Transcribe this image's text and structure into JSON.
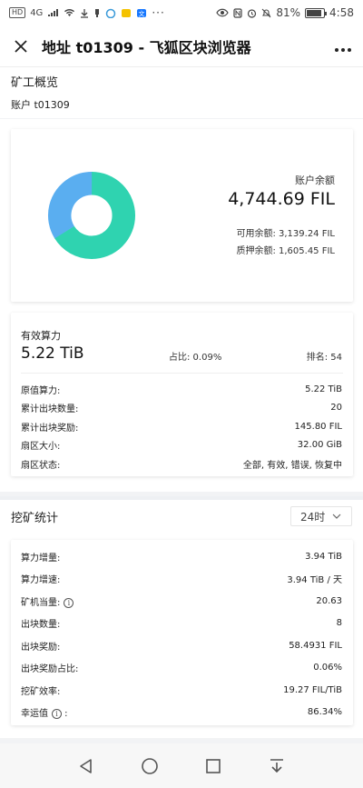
{
  "status_bar": {
    "hd": "HD",
    "network": "4G",
    "dots": "···",
    "battery": "81%",
    "time": "4:58",
    "battery_level": 0.81
  },
  "app_bar": {
    "title": "地址 t01309 - 飞狐区块浏览器"
  },
  "overview": {
    "title": "矿工概览",
    "account": "账户 t01309"
  },
  "balance": {
    "label": "账户余额",
    "value": "4,744.69 FIL",
    "available": "可用余额: 3,139.24 FIL",
    "locked": "质押余额: 1,605.45 FIL",
    "donut": {
      "available_fraction": 0.6616,
      "locked_fraction": 0.3384
    },
    "colors": {
      "available": "#2fd3b0",
      "locked": "#5aaef0"
    }
  },
  "power": {
    "label": "有效算力",
    "value": "5.22 TiB",
    "ratio": "占比: 0.09%",
    "rank": "排名: 54",
    "rows": [
      {
        "label": "原值算力:",
        "value": "5.22 TiB"
      },
      {
        "label": "累计出块数量:",
        "value": "20"
      },
      {
        "label": "累计出块奖励:",
        "value": "145.80 FIL"
      },
      {
        "label": "扇区大小:",
        "value": "32.00 GiB"
      },
      {
        "label": "扇区状态:",
        "value": "全部, 有效, 错误, 恢复中"
      }
    ]
  },
  "mining_stats": {
    "title": "挖矿统计",
    "period": "24时",
    "rows": [
      {
        "label": "算力增量:",
        "value": "3.94 TiB",
        "info": false
      },
      {
        "label": "算力增速:",
        "value": "3.94 TiB / 天",
        "info": false
      },
      {
        "label": "矿机当量:",
        "value": "20.63",
        "info": true
      },
      {
        "label": "出块数量:",
        "value": "8",
        "info": false
      },
      {
        "label": "出块奖励:",
        "value": "58.4931 FIL",
        "info": false
      },
      {
        "label": "出块奖励占比:",
        "value": "0.06%",
        "info": false
      },
      {
        "label": "挖矿效率:",
        "value": "19.27 FIL/TiB",
        "info": false
      },
      {
        "label": "幸运值",
        "value": "86.34%",
        "info": true
      }
    ]
  },
  "nav_bar": {
    "icons": [
      "back-icon",
      "home-icon",
      "recents-icon",
      "notification-shade-icon"
    ]
  }
}
